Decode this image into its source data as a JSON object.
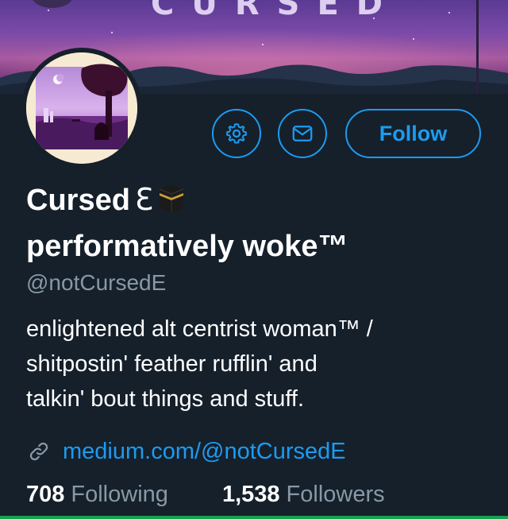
{
  "banner": {
    "text": "CURSED"
  },
  "actions": {
    "follow_label": "Follow"
  },
  "profile": {
    "name_line1": "Cursed",
    "name_symbol": "Ɛ",
    "name_line2": "performatively woke™",
    "handle": "@notCursedE",
    "bio_lines": [
      "enlightened alt centrist woman™ /",
      "shitpostin' feather rufflin' and",
      "talkin' bout things and stuff."
    ],
    "link": "medium.com/@notCursedE"
  },
  "stats": {
    "following_count": "708",
    "following_label": "Following",
    "followers_count": "1,538",
    "followers_label": "Followers"
  },
  "colors": {
    "background": "#15202b",
    "accent": "#1d9bf0",
    "secondary_text": "#8899a6"
  },
  "icons": {
    "settings": "gear-icon",
    "message": "envelope-icon",
    "link": "link-icon",
    "name_emoji": "kaaba-icon"
  }
}
